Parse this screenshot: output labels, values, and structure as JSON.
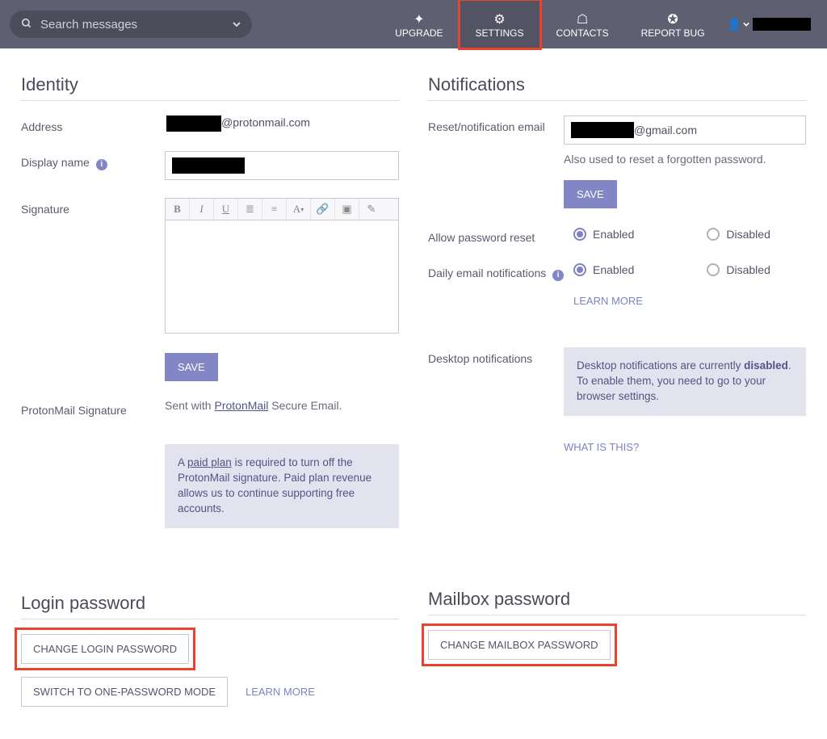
{
  "search": {
    "placeholder": "Search messages"
  },
  "nav": {
    "upgrade": "UPGRADE",
    "settings": "SETTINGS",
    "contacts": "CONTACTS",
    "report_bug": "REPORT BUG"
  },
  "identity": {
    "title": "Identity",
    "address_label": "Address",
    "address_domain": "@protonmail.com",
    "display_name_label": "Display name",
    "signature_label": "Signature",
    "save": "SAVE",
    "pm_sig_label": "ProtonMail Signature",
    "pm_sig_prefix": "Sent with ",
    "pm_sig_link": "ProtonMail",
    "pm_sig_suffix": " Secure Email.",
    "plan_notice_1": "A ",
    "plan_notice_link": "paid plan",
    "plan_notice_2": " is required to turn off the ProtonMail signature. Paid plan revenue allows us to continue supporting free accounts."
  },
  "notifications": {
    "title": "Notifications",
    "reset_label": "Reset/notification email",
    "reset_domain": "@gmail.com",
    "reset_hint": "Also used to reset a forgotten password.",
    "save": "SAVE",
    "allow_reset_label": "Allow password reset",
    "enabled": "Enabled",
    "disabled": "Disabled",
    "daily_label": "Daily email notifications",
    "learn_more": "LEARN MORE",
    "desktop_label": "Desktop notifications",
    "desktop_info_a": "Desktop notifications are currently ",
    "desktop_info_b": "disabled",
    "desktop_info_c": ". To enable them, you need to go to your browser settings.",
    "what_is_this": "WHAT IS THIS?"
  },
  "login_pw": {
    "title": "Login password",
    "change": "CHANGE LOGIN PASSWORD",
    "switch": "SWITCH TO ONE-PASSWORD MODE",
    "learn_more": "LEARN MORE"
  },
  "mailbox_pw": {
    "title": "Mailbox password",
    "change": "CHANGE MAILBOX PASSWORD"
  },
  "toolbar_icons": {
    "bold": "B",
    "italic": "I",
    "underline": "U",
    "ul": "≣",
    "ol": "≡",
    "font": "A",
    "link": "🔗",
    "image": "▣",
    "eraser": "✎"
  }
}
